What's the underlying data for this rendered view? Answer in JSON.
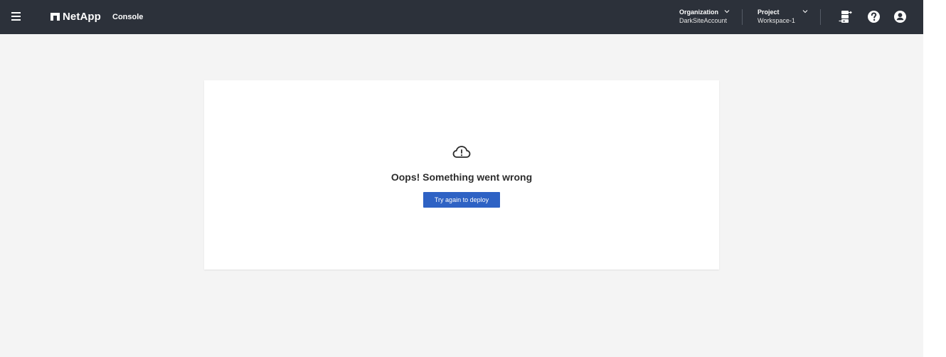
{
  "header": {
    "brand": "NetApp",
    "app_name": "Console",
    "organization": {
      "label": "Organization",
      "value": "DarkSiteAccount"
    },
    "project": {
      "label": "Project",
      "value": "Workspace-1"
    },
    "icons": [
      "menu-icon",
      "netapp-logo-icon",
      "chevron-down-icon",
      "connector-icon",
      "help-icon",
      "user-icon"
    ]
  },
  "error": {
    "icon": "cloud-alert-icon",
    "title": "Oops! Something went wrong",
    "button_label": "Try again to deploy"
  },
  "colors": {
    "topbar": "#2c313a",
    "page_background": "#f4f4f4",
    "card_background": "#ffffff",
    "primary_button": "#2e62c4"
  }
}
